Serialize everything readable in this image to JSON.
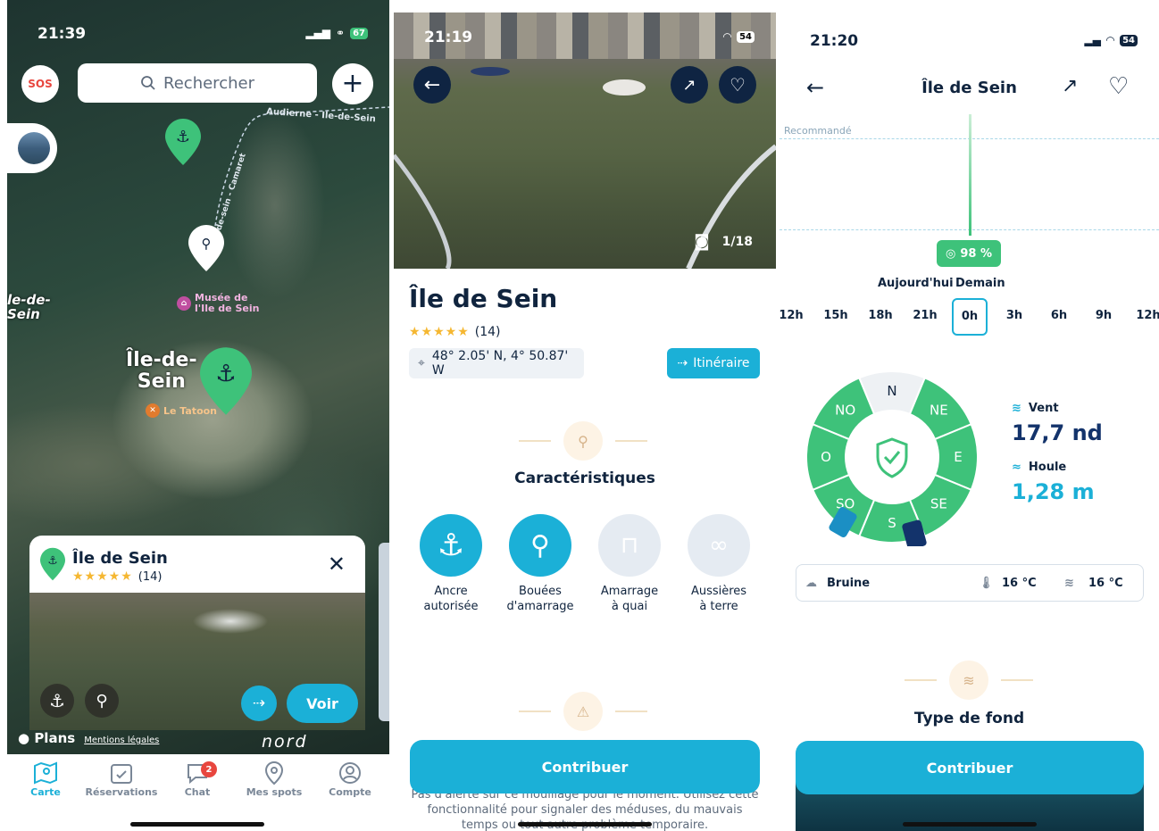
{
  "screen1": {
    "status": {
      "time": "21:39",
      "battery": "67"
    },
    "sos_label": "SOS",
    "search": {
      "placeholder": "Rechercher"
    },
    "map_labels": {
      "route": "Audierne - Ile-de-Sein",
      "route2": "de-sein - Camaret",
      "left_label": "le-de-\nSein",
      "town": "Île-de-\nSein",
      "museum": "Musée de\nl'Ile de Sein",
      "restaurant": "Le Tatoon"
    },
    "card": {
      "title": "Île de Sein",
      "rating_count": "(14)",
      "voir_label": "Voir"
    },
    "attribution": {
      "plans": "Plans",
      "mentions": "Mentions légales",
      "nord": "nord"
    },
    "tabs": [
      {
        "label": "Carte",
        "icon": "map-icon"
      },
      {
        "label": "Réservations",
        "icon": "calendar-icon"
      },
      {
        "label": "Chat",
        "icon": "chat-icon",
        "badge": "2"
      },
      {
        "label": "Mes spots",
        "icon": "pin-icon"
      },
      {
        "label": "Compte",
        "icon": "user-icon"
      }
    ]
  },
  "screen2": {
    "status": {
      "time": "21:19",
      "battery": "54"
    },
    "photo_counter": "1/18",
    "title": "Île de Sein",
    "rating_count": "(14)",
    "coordinates": "48° 2.05' N, 4° 50.87' W",
    "itinerary_label": "Itinéraire",
    "characteristics_title": "Caractéristiques",
    "features": [
      {
        "line1": "Ancre",
        "line2": "autorisée",
        "active": true,
        "icon": "anchor-icon"
      },
      {
        "line1": "Bouées",
        "line2": "d'amarrage",
        "active": true,
        "icon": "buoy-icon"
      },
      {
        "line1": "Amarrage",
        "line2": "à quai",
        "active": false,
        "icon": "dock-icon"
      },
      {
        "line1": "Aussières",
        "line2": "à terre",
        "active": false,
        "icon": "rope-icon"
      }
    ],
    "contribute_label": "Contribuer",
    "help_text": "Pas d'alerte sur ce mouillage pour le moment. Utilisez cette fonctionnalité pour signaler des méduses, du mauvais temps ou tout autre problème temporaire."
  },
  "screen3": {
    "status": {
      "time": "21:20",
      "battery": "54"
    },
    "title": "Île de Sein",
    "recommended_label": "Recommandé",
    "score": "98 %",
    "day_today": "Aujourd'hui",
    "day_tomorrow": "Demain",
    "hours": [
      "12h",
      "15h",
      "18h",
      "21h",
      "0h",
      "3h",
      "6h",
      "9h",
      "12h"
    ],
    "selected_hour_index": 4,
    "compass": [
      "N",
      "NE",
      "E",
      "SE",
      "S",
      "SO",
      "O",
      "NO"
    ],
    "wind_label": "Vent",
    "wind_value": "17,7 nd",
    "swell_label": "Houle",
    "swell_value": "1,28 m",
    "weather": {
      "condition": "Bruine",
      "air_temp": "16 °C",
      "water_temp": "16 °C"
    },
    "seabed_title": "Type de fond",
    "contribute_label": "Contribuer"
  },
  "colors": {
    "accent": "#1bb0d7",
    "green": "#3ec27a",
    "navy": "#10243e",
    "badge_red": "#e8463e"
  }
}
